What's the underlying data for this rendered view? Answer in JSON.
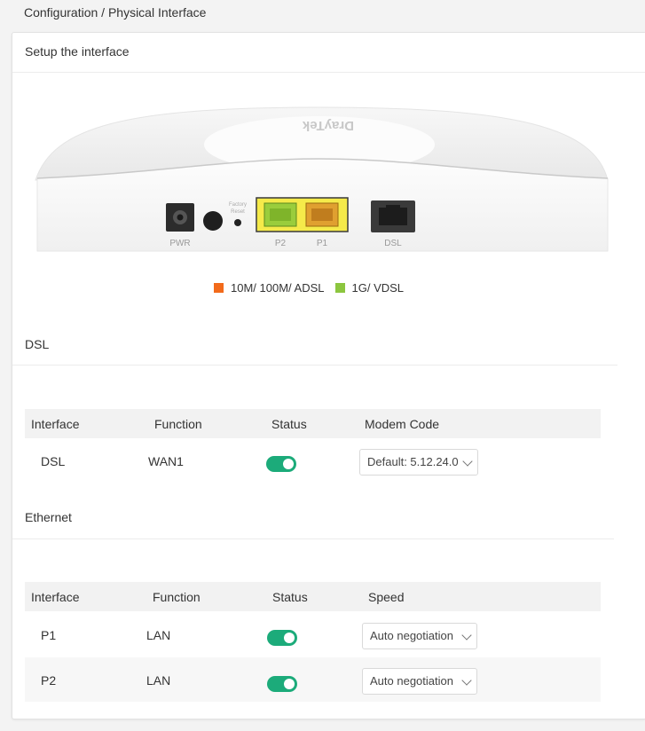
{
  "breadcrumb": "Configuration / Physical Interface",
  "panel_title": "Setup the interface",
  "device": {
    "brand": "DrayTek",
    "ports": {
      "pwr": "PWR",
      "reset_line1": "Factory",
      "reset_line2": "Reset",
      "p2": "P2",
      "p1": "P1",
      "dsl": "DSL"
    }
  },
  "legend": [
    {
      "label": "10M/ 100M/ ADSL",
      "color": "#f26a1b"
    },
    {
      "label": "1G/ VDSL",
      "color": "#8cc63f"
    }
  ],
  "dsl": {
    "title": "DSL",
    "headers": [
      "Interface",
      "Function",
      "Status",
      "Modem Code"
    ],
    "rows": [
      {
        "interface": "DSL",
        "function": "WAN1",
        "status": true,
        "option": "Default: 5.12.24.0"
      }
    ]
  },
  "ethernet": {
    "title": "Ethernet",
    "headers": [
      "Interface",
      "Function",
      "Status",
      "Speed"
    ],
    "rows": [
      {
        "interface": "P1",
        "function": "LAN",
        "status": true,
        "option": "Auto negotiation"
      },
      {
        "interface": "P2",
        "function": "LAN",
        "status": true,
        "option": "Auto negotiation"
      }
    ]
  },
  "colors": {
    "toggle_on": "#1cab7a",
    "port_highlight": "#f5ea4a"
  }
}
